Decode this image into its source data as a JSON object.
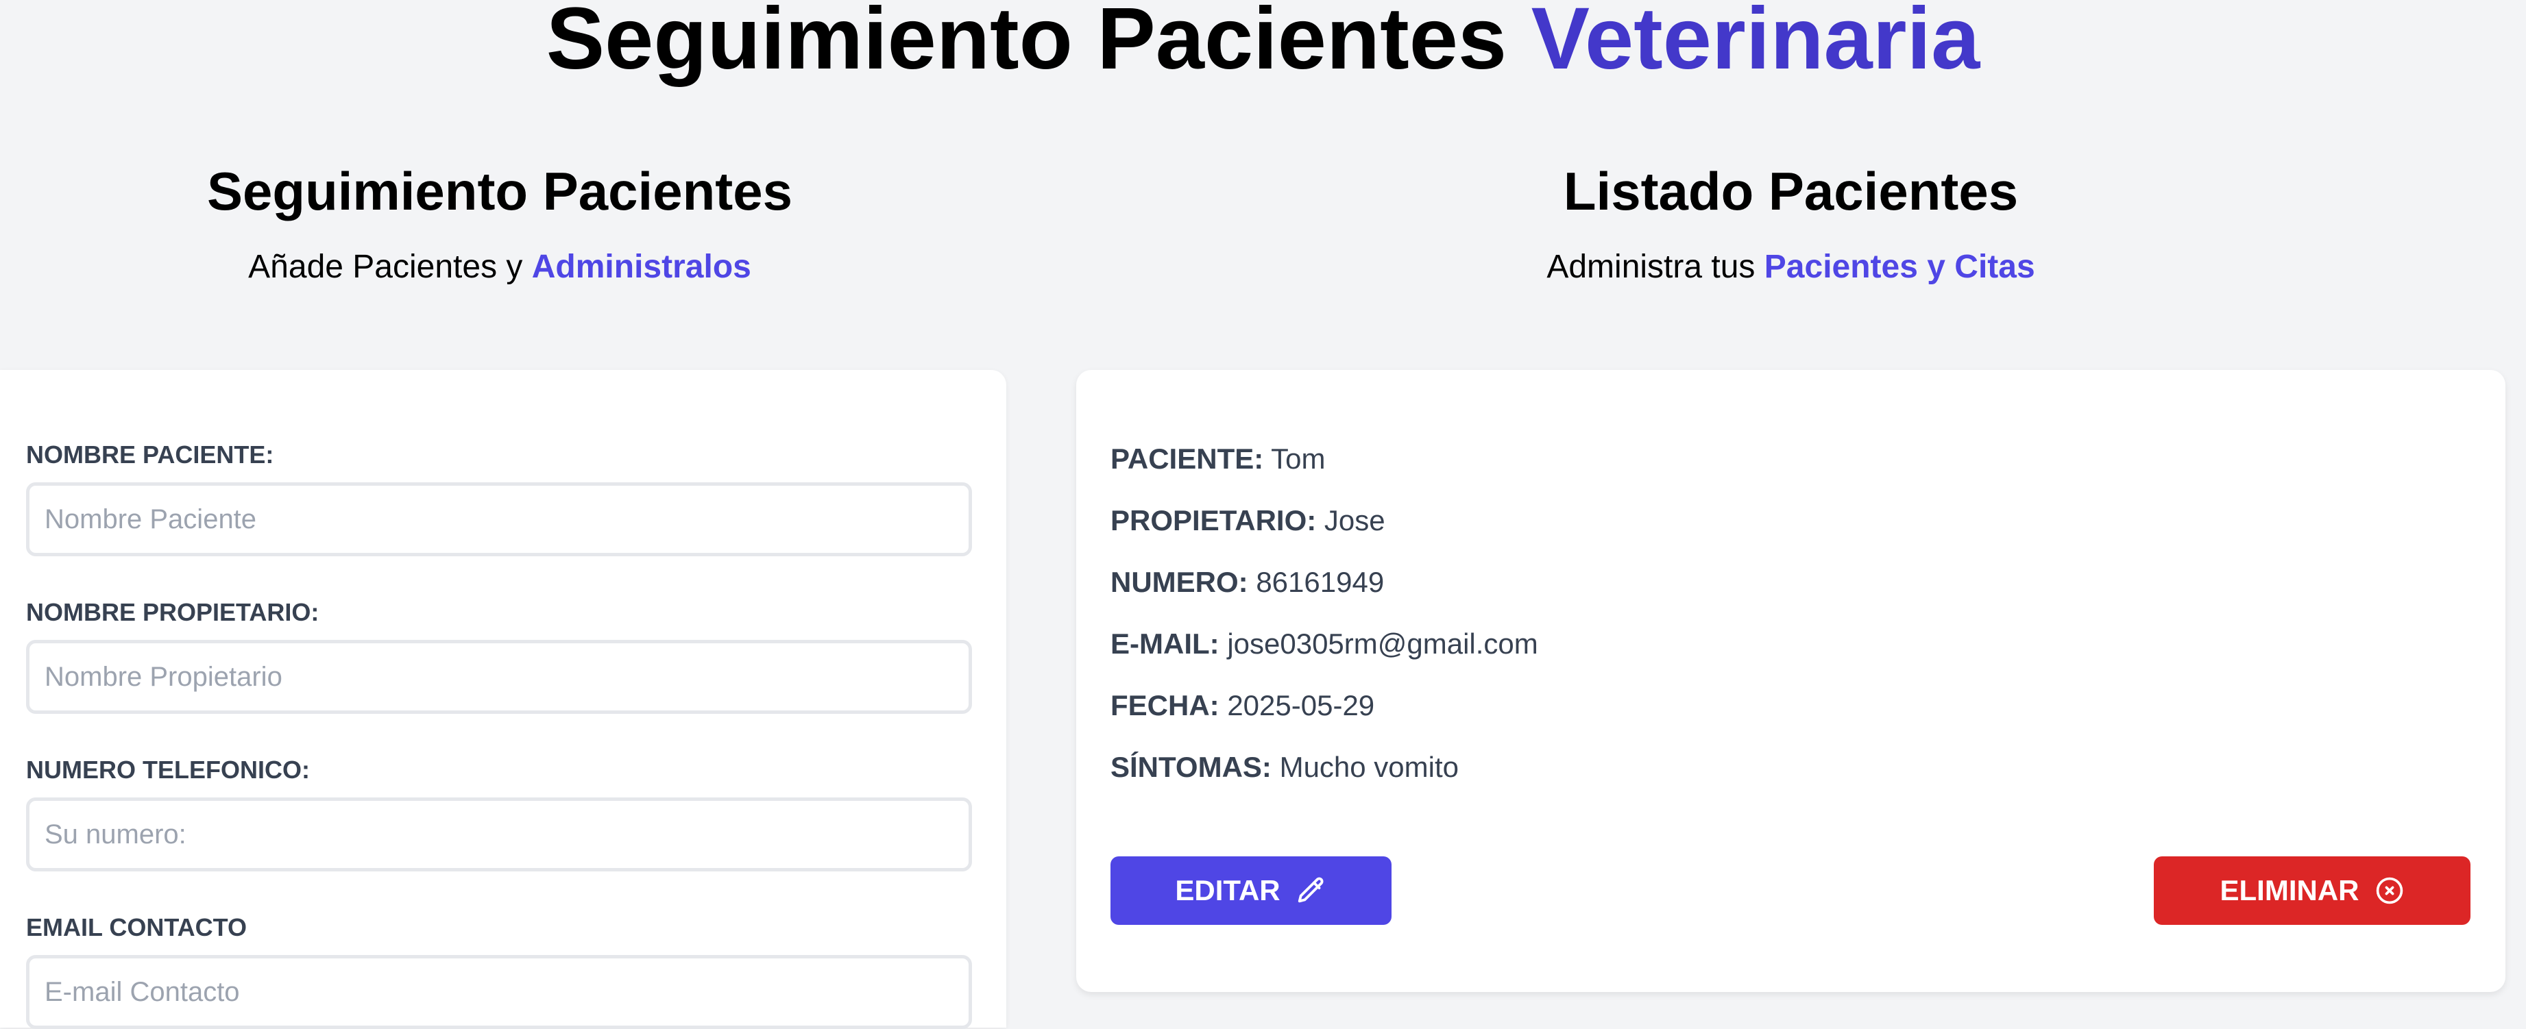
{
  "header": {
    "title_part1": "Seguimiento Pacientes",
    "title_part2": "Veterinaria"
  },
  "form_section": {
    "title": "Seguimiento Pacientes",
    "subtitle_plain": "Añade Pacientes y",
    "subtitle_accent": "Administralos",
    "fields": [
      {
        "label": "NOMBRE PACIENTE:",
        "placeholder": "Nombre Paciente",
        "value": ""
      },
      {
        "label": "NOMBRE PROPIETARIO:",
        "placeholder": "Nombre Propietario",
        "value": ""
      },
      {
        "label": "NUMERO TELEFONICO:",
        "placeholder": "Su numero:",
        "value": ""
      },
      {
        "label": "EMAIL CONTACTO",
        "placeholder": "E-mail Contacto",
        "value": ""
      }
    ]
  },
  "list_section": {
    "title": "Listado Pacientes",
    "subtitle_plain": "Administra tus",
    "subtitle_accent": "Pacientes y Citas",
    "patients": [
      {
        "rows": [
          {
            "key": "PACIENTE:",
            "value": "Tom"
          },
          {
            "key": "PROPIETARIO:",
            "value": "Jose"
          },
          {
            "key": "NUMERO:",
            "value": "86161949"
          },
          {
            "key": "E-MAIL:",
            "value": "jose0305rm@gmail.com"
          },
          {
            "key": "FECHA:",
            "value": "2025-05-29"
          },
          {
            "key": "SÍNTOMAS:",
            "value": "Mucho vomito"
          }
        ],
        "edit_label": "EDITAR",
        "delete_label": "ELIMINAR"
      }
    ]
  },
  "colors": {
    "background": "#f3f4f6",
    "accent": "#4338ca",
    "edit_button": "#4f46e5",
    "delete_button": "#dc2626"
  },
  "icons": {
    "edit": "pencil-icon",
    "delete": "x-circle-icon"
  }
}
